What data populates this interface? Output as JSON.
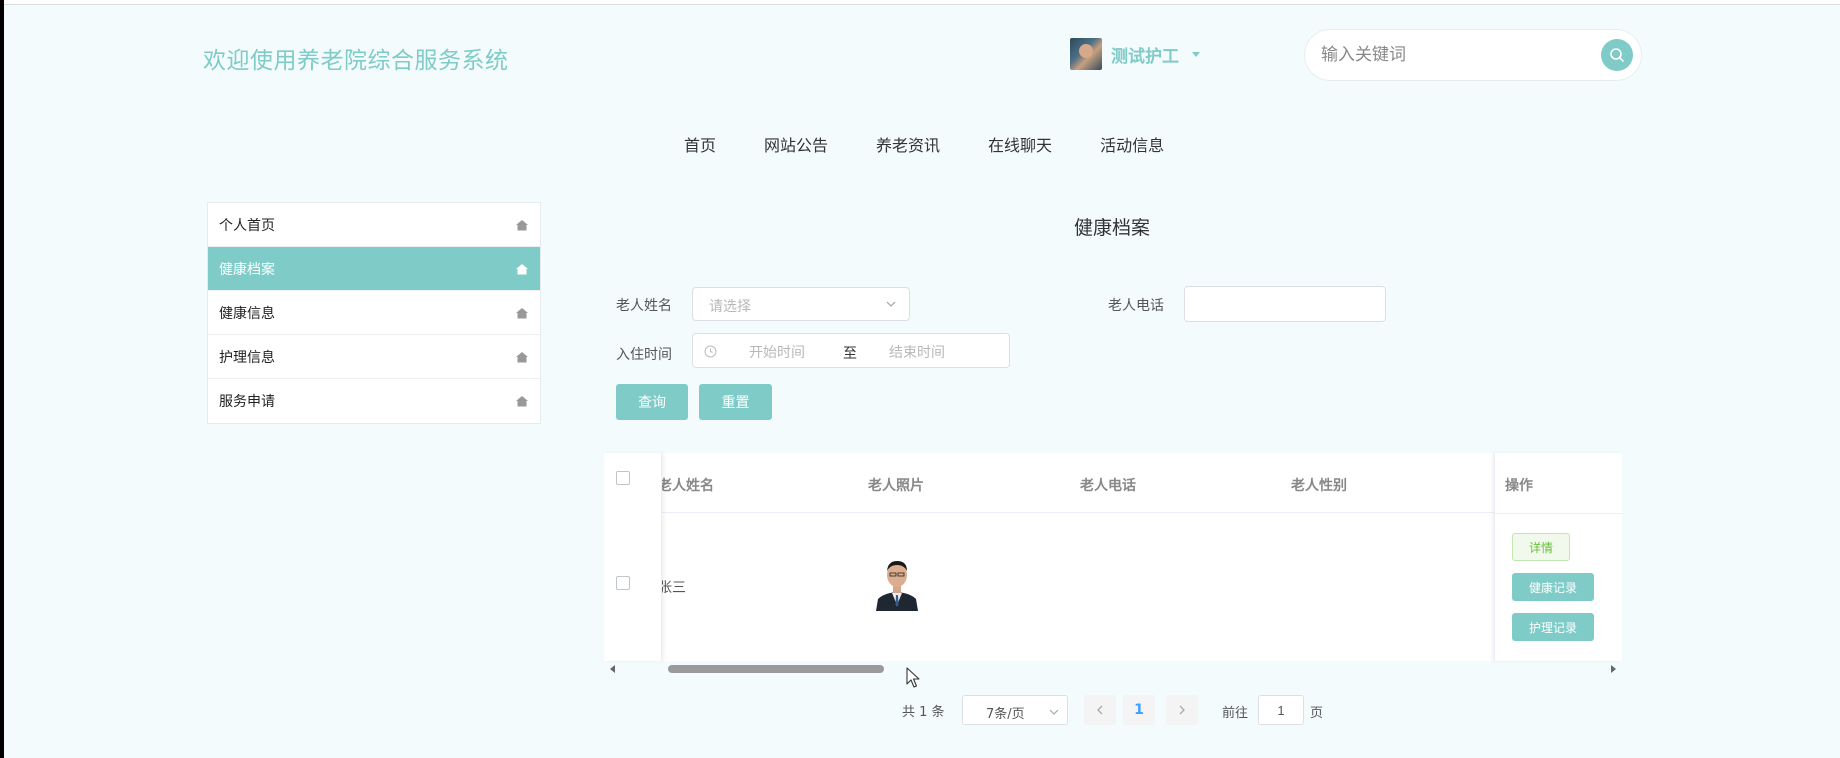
{
  "header": {
    "site_title": "欢迎使用养老院综合服务系统",
    "user_name": "测试护工",
    "search_placeholder": "输入关键词"
  },
  "nav": [
    "首页",
    "网站公告",
    "养老资讯",
    "在线聊天",
    "活动信息"
  ],
  "sidebar": {
    "items": [
      {
        "label": "个人首页",
        "active": false
      },
      {
        "label": "健康档案",
        "active": true
      },
      {
        "label": "健康信息",
        "active": false
      },
      {
        "label": "护理信息",
        "active": false
      },
      {
        "label": "服务申请",
        "active": false
      }
    ]
  },
  "main": {
    "title": "健康档案",
    "filters": {
      "name_label": "老人姓名",
      "name_placeholder": "请选择",
      "phone_label": "老人电话",
      "date_label": "入住时间",
      "date_start_placeholder": "开始时间",
      "date_sep": "至",
      "date_end_placeholder": "结束时间"
    },
    "buttons": {
      "search": "查询",
      "reset": "重置"
    },
    "table": {
      "columns": [
        "老人姓名",
        "老人照片",
        "老人电话",
        "老人性别",
        "操作"
      ],
      "rows": [
        {
          "name": "张三",
          "phone": "",
          "gender": ""
        }
      ],
      "actions": {
        "detail": "详情",
        "health": "健康记录",
        "nursing": "护理记录"
      }
    },
    "pagination": {
      "total": "共 1 条",
      "page_size": "7条/页",
      "current": "1",
      "goto_label": "前往",
      "goto_value": "1",
      "page_suffix": "页"
    }
  },
  "colors": {
    "accent": "#7ecbc7",
    "background": "#f4fbfd",
    "link": "#409eff"
  }
}
